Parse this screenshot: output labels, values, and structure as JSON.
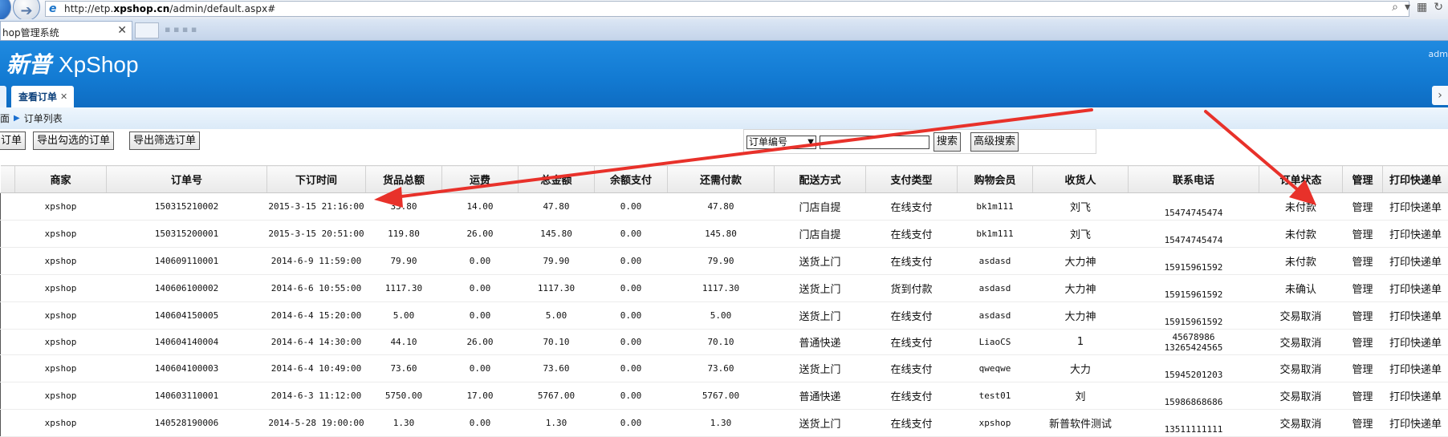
{
  "browser": {
    "url_prefix": "http://etp.",
    "url_domain": "xpshop.cn",
    "url_suffix": "/admin/default.aspx#",
    "tab_title": "hop管理系统"
  },
  "header": {
    "brand_cn": "新普",
    "brand_en": "XpShop",
    "user": "adm",
    "tab_label": "查看订单"
  },
  "breadcrumb": {
    "parent": "面",
    "current": "订单列表"
  },
  "toolbar": {
    "btn_order": "订单",
    "btn_export_checked": "导出勾选的订单",
    "btn_export_filtered": "导出筛选订单",
    "search_field_selected": "订单编号",
    "search_value": "",
    "btn_search": "搜索",
    "btn_advanced": "高级搜索"
  },
  "table": {
    "columns": [
      "商家",
      "订单号",
      "下订时间",
      "货品总额",
      "运费",
      "总金额",
      "余额支付",
      "还需付款",
      "配送方式",
      "支付类型",
      "购物会员",
      "收货人",
      "联系电话",
      "订单状态",
      "管理",
      "打印快递单"
    ],
    "rows": [
      {
        "merchant": "xpshop",
        "order_no": "150315210002",
        "time": "2015-3-15 21:16:00",
        "goods": "33.80",
        "freight": "14.00",
        "total": "47.80",
        "balance": "0.00",
        "due": "47.80",
        "shipping": "门店自提",
        "pay": "在线支付",
        "member": "bk1m111",
        "receiver": "刘飞",
        "phone": [
          "15474745474"
        ],
        "status": "未付款",
        "manage": "管理",
        "print": "打印快递单"
      },
      {
        "merchant": "xpshop",
        "order_no": "150315200001",
        "time": "2015-3-15 20:51:00",
        "goods": "119.80",
        "freight": "26.00",
        "total": "145.80",
        "balance": "0.00",
        "due": "145.80",
        "shipping": "门店自提",
        "pay": "在线支付",
        "member": "bk1m111",
        "receiver": "刘飞",
        "phone": [
          "15474745474"
        ],
        "status": "未付款",
        "manage": "管理",
        "print": "打印快递单"
      },
      {
        "merchant": "xpshop",
        "order_no": "140609110001",
        "time": "2014-6-9 11:59:00",
        "goods": "79.90",
        "freight": "0.00",
        "total": "79.90",
        "balance": "0.00",
        "due": "79.90",
        "shipping": "送货上门",
        "pay": "在线支付",
        "member": "asdasd",
        "receiver": "大力神",
        "phone": [
          "15915961592"
        ],
        "status": "未付款",
        "manage": "管理",
        "print": "打印快递单"
      },
      {
        "merchant": "xpshop",
        "order_no": "140606100002",
        "time": "2014-6-6 10:55:00",
        "goods": "1117.30",
        "freight": "0.00",
        "total": "1117.30",
        "balance": "0.00",
        "due": "1117.30",
        "shipping": "送货上门",
        "pay": "货到付款",
        "member": "asdasd",
        "receiver": "大力神",
        "phone": [
          "15915961592"
        ],
        "status": "未确认",
        "manage": "管理",
        "print": "打印快递单"
      },
      {
        "merchant": "xpshop",
        "order_no": "140604150005",
        "time": "2014-6-4 15:20:00",
        "goods": "5.00",
        "freight": "0.00",
        "total": "5.00",
        "balance": "0.00",
        "due": "5.00",
        "shipping": "送货上门",
        "pay": "在线支付",
        "member": "asdasd",
        "receiver": "大力神",
        "phone": [
          "15915961592"
        ],
        "status": "交易取消",
        "manage": "管理",
        "print": "打印快递单"
      },
      {
        "merchant": "xpshop",
        "order_no": "140604140004",
        "time": "2014-6-4 14:30:00",
        "goods": "44.10",
        "freight": "26.00",
        "total": "70.10",
        "balance": "0.00",
        "due": "70.10",
        "shipping": "普通快递",
        "pay": "在线支付",
        "member": "LiaoCS",
        "receiver": "1",
        "phone": [
          "45678986",
          "13265424565"
        ],
        "status": "交易取消",
        "manage": "管理",
        "print": "打印快递单"
      },
      {
        "merchant": "xpshop",
        "order_no": "140604100003",
        "time": "2014-6-4 10:49:00",
        "goods": "73.60",
        "freight": "0.00",
        "total": "73.60",
        "balance": "0.00",
        "due": "73.60",
        "shipping": "送货上门",
        "pay": "在线支付",
        "member": "qweqwe",
        "receiver": "大力",
        "phone": [
          "15945201203"
        ],
        "status": "交易取消",
        "manage": "管理",
        "print": "打印快递单"
      },
      {
        "merchant": "xpshop",
        "order_no": "140603110001",
        "time": "2014-6-3 11:12:00",
        "goods": "5750.00",
        "freight": "17.00",
        "total": "5767.00",
        "balance": "0.00",
        "due": "5767.00",
        "shipping": "普通快递",
        "pay": "在线支付",
        "member": "test01",
        "receiver": "刘",
        "phone": [
          "15986868686"
        ],
        "status": "交易取消",
        "manage": "管理",
        "print": "打印快递单"
      },
      {
        "merchant": "xpshop",
        "order_no": "140528190006",
        "time": "2014-5-28 19:00:00",
        "goods": "1.30",
        "freight": "0.00",
        "total": "1.30",
        "balance": "0.00",
        "due": "1.30",
        "shipping": "送货上门",
        "pay": "在线支付",
        "member": "xpshop",
        "receiver": "新普软件测试",
        "phone": [
          "13511111111"
        ],
        "status": "交易取消",
        "manage": "管理",
        "print": "打印快递单"
      }
    ]
  },
  "colors": {
    "header_blue": "#137bd3",
    "arrow_red": "#e8312a"
  }
}
